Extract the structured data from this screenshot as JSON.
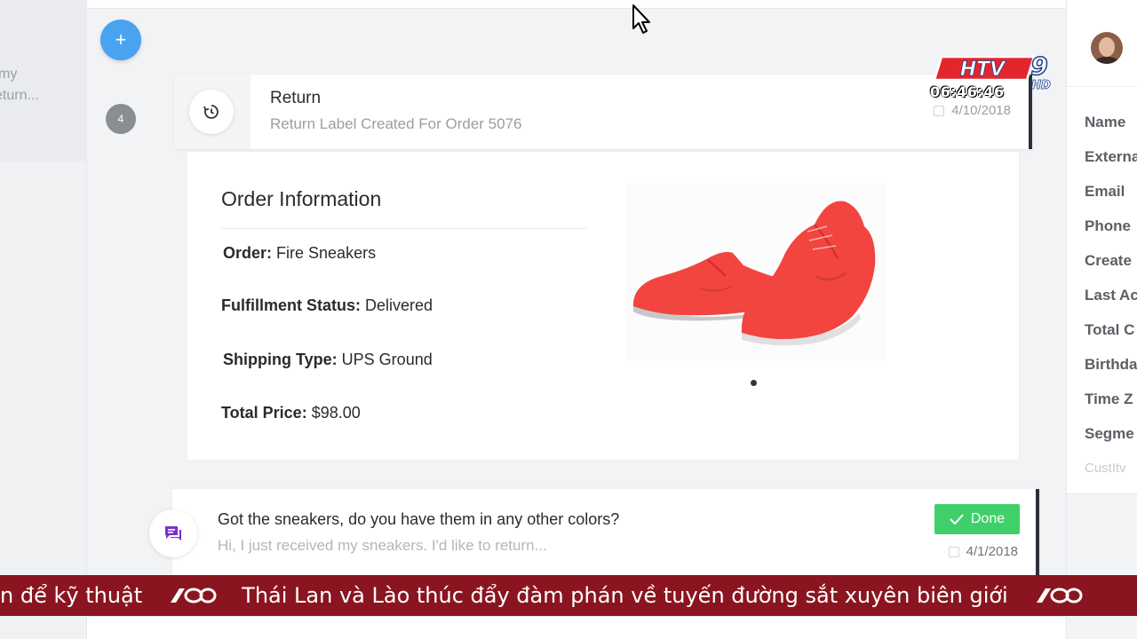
{
  "left_preview": {
    "line1": "my",
    "line2": "eturn..."
  },
  "timeline": {
    "add_symbol": "+",
    "step_number": "4"
  },
  "return_event": {
    "title": "Return",
    "subtitle": "Return Label Created For Order 5076",
    "date": "4/10/2018",
    "icon": "history-icon"
  },
  "order_info": {
    "heading": "Order Information",
    "rows": [
      {
        "label": "Order:",
        "value": "Fire Sneakers"
      },
      {
        "label": "Fulfillment Status:",
        "value": "Delivered"
      },
      {
        "label": "Shipping Type:",
        "value": "UPS Ground"
      },
      {
        "label": "Total Price:",
        "value": "$98.00"
      }
    ],
    "image": "red-sneakers",
    "product_color": "#f2453f"
  },
  "message_event": {
    "title": "Got the sneakers, do you have them in any other colors?",
    "preview": "Hi, I just received my sneakers. I'd like to return...",
    "status_label": "Done",
    "date": "4/1/2018",
    "icon": "chat-icon",
    "icon_color": "#7b2fd0",
    "status_color": "#3fd06a"
  },
  "customer_panel": {
    "fields": [
      "Name",
      "Externa",
      "Email",
      "Phone",
      "Create",
      "Last Ac",
      "Total C",
      "Birthda",
      "Time Z",
      "Segme",
      "CustItv"
    ]
  },
  "tv_overlay": {
    "channel_letters": "HTV",
    "channel_number": "9",
    "channel_suffix": "HD",
    "clock": "06:46:46",
    "ticker_left": "n để kỹ thuật",
    "ticker_main": "Thái Lan và Lào thúc đẩy đàm phán về tuyến đường sắt xuyên biên giới",
    "ticker_color": "#8a1520"
  },
  "colors": {
    "accent_blue": "#4aa3f0",
    "dark_border": "#2b2f36"
  }
}
